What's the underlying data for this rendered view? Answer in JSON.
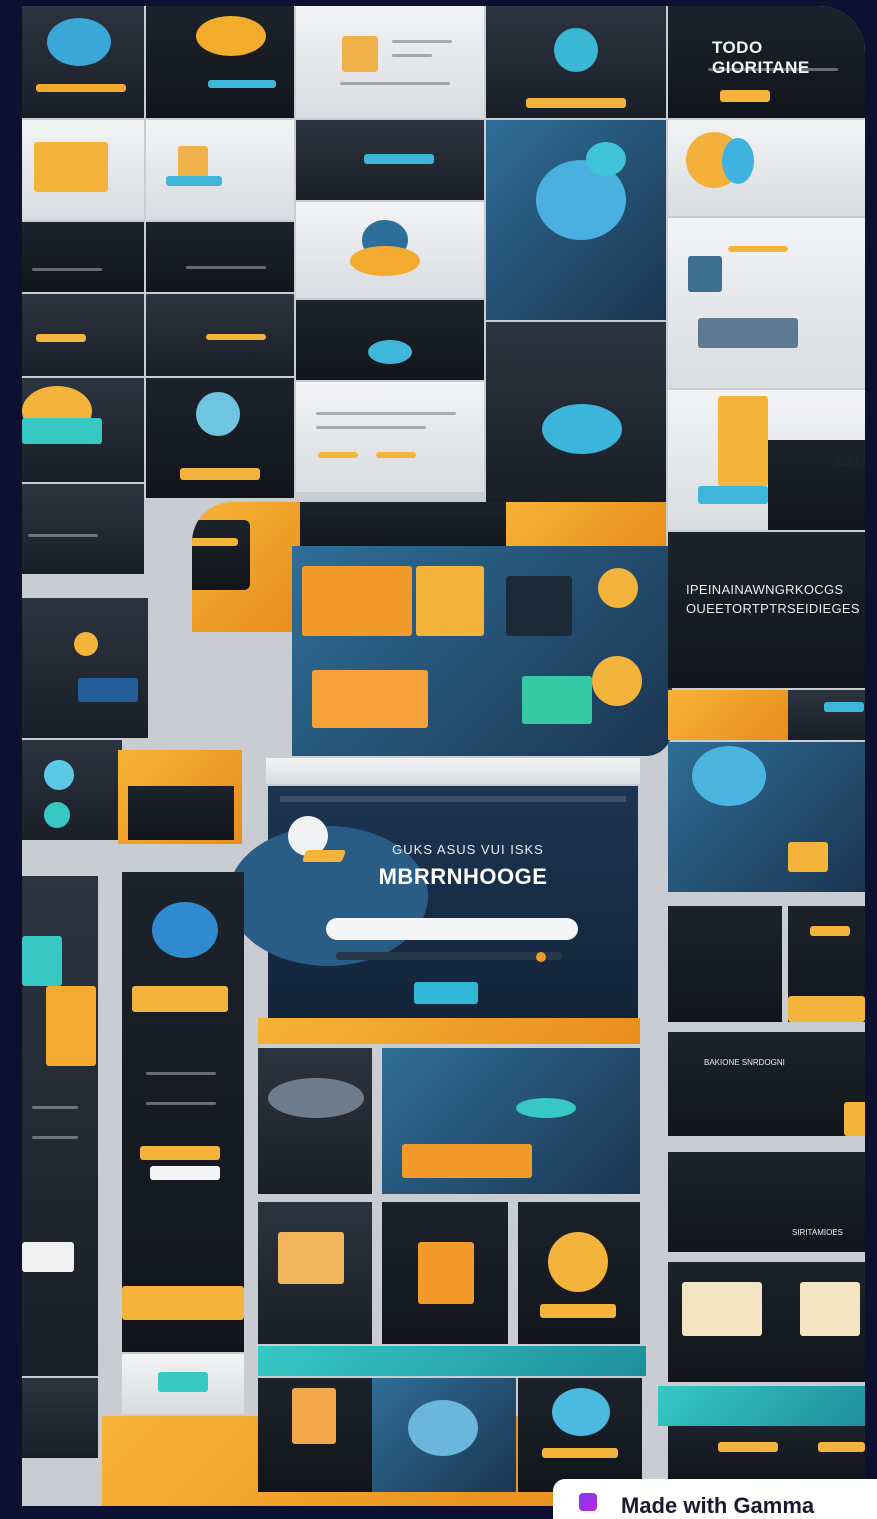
{
  "image": {
    "corner_title": "ТОDО GIORITANE",
    "hero_kicker": "GUKS ASUS VUI ISKS",
    "hero_title": "MBRRNHOOGE",
    "side_text_line1": "IPEINAINAWNGRKOCGS",
    "side_text_line2": "OUEETORTPTRSEIDIEGES",
    "side_short": "DAI",
    "tile_label_1": "BAKIONE SNRDOGNI",
    "tile_label_2": "SIRITAMIOES",
    "colors": {
      "background": "#0d1030",
      "accent_orange": "#f6b335",
      "accent_blue": "#2f6e98",
      "accent_teal": "#37c8c4",
      "dark_tile": "#1d232b"
    }
  },
  "badge": {
    "label": "Made with Gamma",
    "icon": "gamma-logo-icon"
  }
}
